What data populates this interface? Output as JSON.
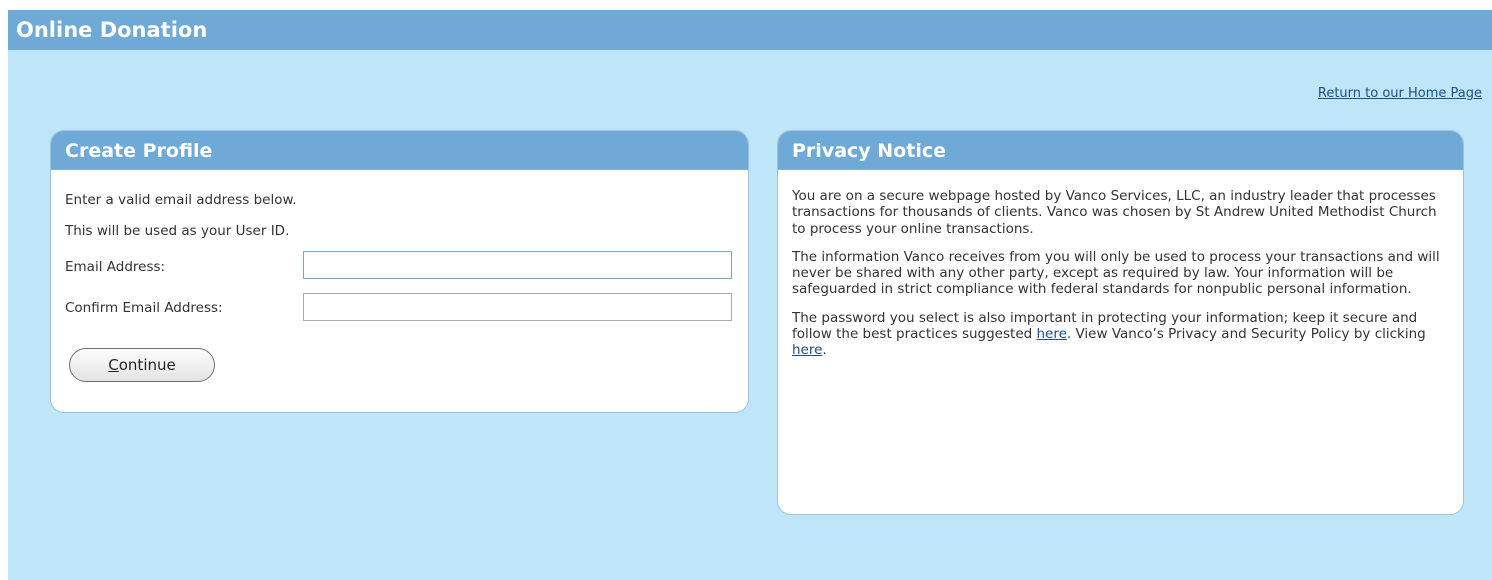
{
  "header": {
    "title": "Online Donation"
  },
  "nav": {
    "home_link": "Return to our Home Page"
  },
  "create_profile": {
    "title": "Create Profile",
    "line1": "Enter a valid email address below.",
    "line2": "This will be used as your User ID.",
    "email_label": "Email Address:",
    "email_value": "",
    "confirm_label": "Confirm Email Address:",
    "confirm_value": "",
    "continue_access_key": "C",
    "continue_rest": "ontinue"
  },
  "privacy": {
    "title": "Privacy Notice",
    "para1": "You are on a secure webpage hosted by Vanco Services, LLC, an industry leader that processes transactions for thousands of clients. Vanco was chosen by St Andrew United Methodist Church to process your online transactions.",
    "para2": "The information Vanco receives from you will only be used to process your transactions and will never be shared with any other party, except as required by law. Your information will be safeguarded in strict compliance with federal standards for nonpublic personal information.",
    "para3_part1": "The password you select is also important in protecting your information; keep it secure and follow the best practices suggested ",
    "para3_link1": "here",
    "para3_part2": ". View Vanco’s Privacy and Security Policy by clicking ",
    "para3_link2": "here",
    "para3_part3": "."
  },
  "colors": {
    "page_background": "#bfe5f8",
    "header_bar": "#6fa9d6",
    "link": "#1f4f87"
  }
}
